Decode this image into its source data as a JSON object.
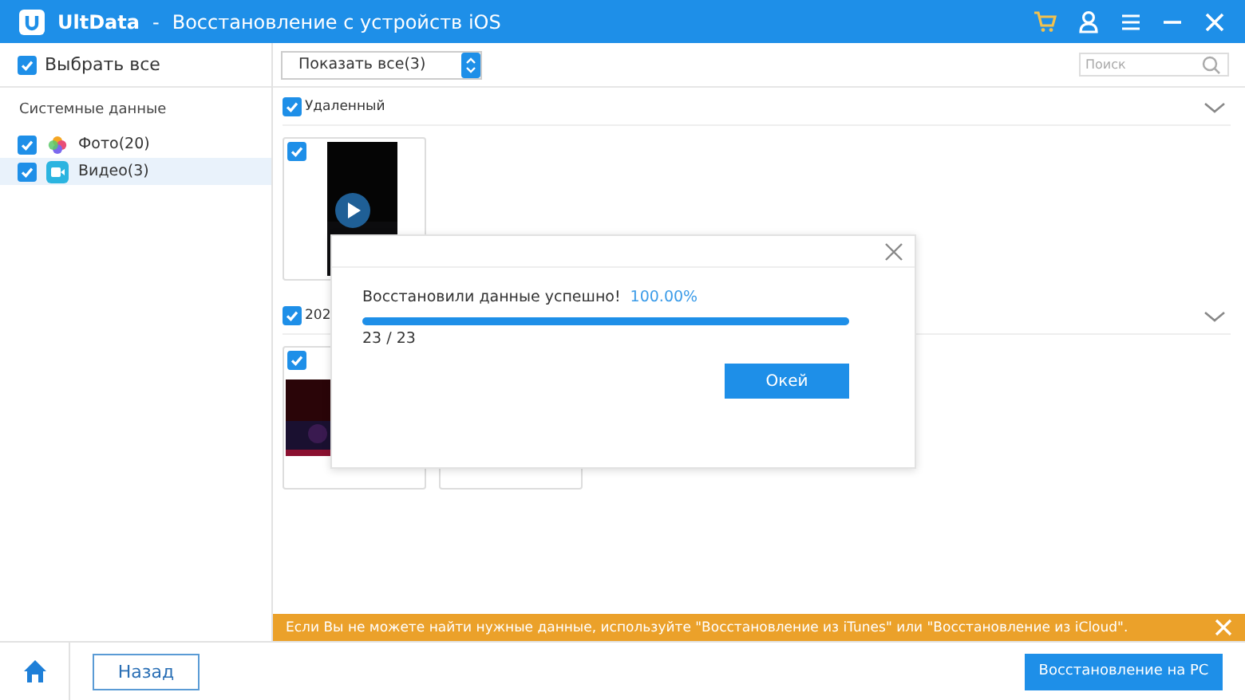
{
  "window": {
    "app_name": "UltData",
    "separator": "-",
    "title": "Восстановление с устройств iOS"
  },
  "sidebar": {
    "select_all": {
      "label": "Выбрать все",
      "checked": true
    },
    "section": "Системные данные",
    "items": [
      {
        "label": "Фото(20)",
        "checked": true,
        "selected": false
      },
      {
        "label": "Видео(3)",
        "checked": true,
        "selected": true,
        "kind": "video"
      }
    ]
  },
  "toolbar": {
    "filter": "Показать все(3)",
    "search": {
      "placeholder": "Поиск"
    }
  },
  "groups": [
    {
      "title": "Удаленный",
      "checked": true,
      "expanded": true,
      "items": [
        {
          "checked": true,
          "kind": "video"
        }
      ]
    },
    {
      "title": "202",
      "checked": true,
      "expanded": true,
      "items": [
        {
          "checked": true,
          "kind": "dark"
        },
        {
          "kind": "blank"
        }
      ]
    }
  ],
  "dialog": {
    "message": "Восстановили данные успешно!",
    "percent": "100.00%",
    "level": 1,
    "count": "23 / 23",
    "button": "Окей"
  },
  "notice": "Если Вы не можете найти нужные данные, используйте \"Восстановление из iTunes\" или \"Восстановление из iCloud\".",
  "footer": {
    "back": "Назад",
    "recover": "Восстановление на PC"
  }
}
